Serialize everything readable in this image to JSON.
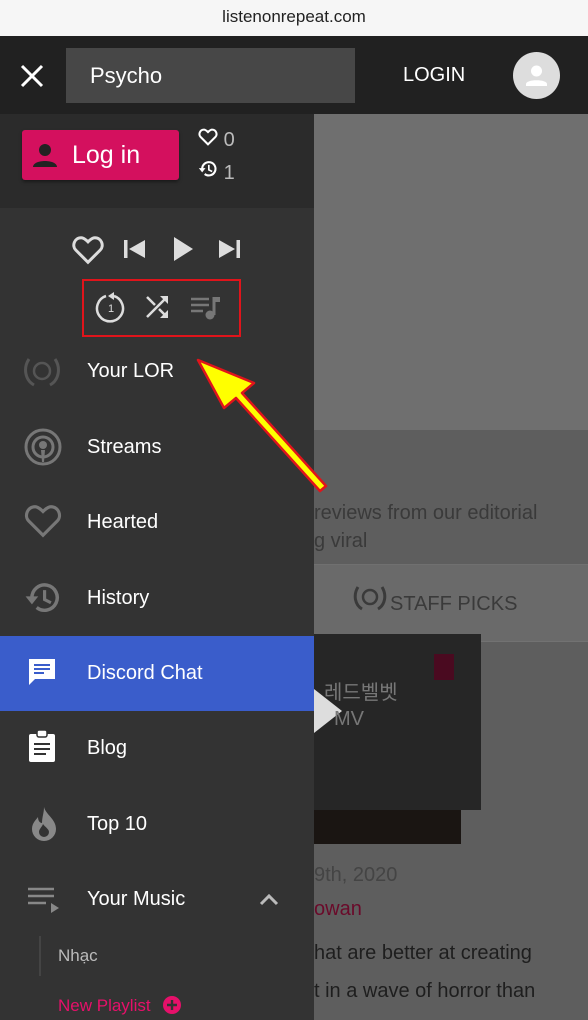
{
  "browser": {
    "url": "listenonrepeat.com"
  },
  "header": {
    "search_value": "Psycho",
    "login_label": "LOGIN"
  },
  "account": {
    "login_button": "Log in",
    "hearts_count": "0",
    "history_count": "1"
  },
  "player": {
    "controls": [
      "heart-icon",
      "skip-previous-icon",
      "play-icon",
      "skip-next-icon"
    ],
    "modes": [
      "repeat-one-icon",
      "shuffle-icon",
      "queue-music-icon"
    ]
  },
  "menu": {
    "items": [
      {
        "label": "Your LOR",
        "icon": "laurel-repeat-icon"
      },
      {
        "label": "Streams",
        "icon": "podcast-icon"
      },
      {
        "label": "Hearted",
        "icon": "heart-icon"
      },
      {
        "label": "History",
        "icon": "history-icon"
      },
      {
        "label": "Discord Chat",
        "icon": "chat-icon",
        "active": true
      },
      {
        "label": "Blog",
        "icon": "clipboard-icon"
      },
      {
        "label": "Top 10",
        "icon": "flame-icon"
      },
      {
        "label": "Your Music",
        "icon": "playlist-icon"
      }
    ],
    "playlists": [
      "Nhạc"
    ],
    "new_playlist": "New Playlist"
  },
  "background": {
    "desc_line1": "reviews from our editorial",
    "desc_line2": "g viral",
    "tab_label": "STAFF PICKS",
    "video_title1": "레드벨벳",
    "video_title2": "MV",
    "date": "9th, 2020",
    "author": "owan",
    "body_line1": "hat are better at creating",
    "body_line2": "t in a wave of horror than"
  },
  "colors": {
    "accent": "#d4105e",
    "active": "#3a5dcb",
    "drawer": "#333333",
    "highlight_box": "#e0141b",
    "arrow": "#ffff00"
  }
}
